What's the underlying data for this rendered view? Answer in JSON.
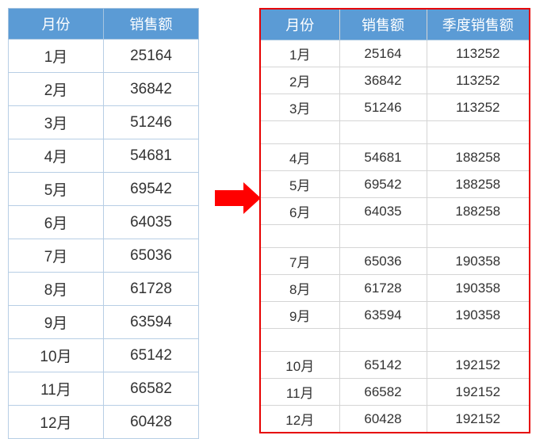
{
  "chart_data": {
    "type": "table",
    "left": {
      "headers": {
        "month": "月份",
        "sales": "销售额"
      },
      "rows": [
        {
          "month": "1月",
          "sales": 25164
        },
        {
          "month": "2月",
          "sales": 36842
        },
        {
          "month": "3月",
          "sales": 51246
        },
        {
          "month": "4月",
          "sales": 54681
        },
        {
          "month": "5月",
          "sales": 69542
        },
        {
          "month": "6月",
          "sales": 64035
        },
        {
          "month": "7月",
          "sales": 65036
        },
        {
          "month": "8月",
          "sales": 61728
        },
        {
          "month": "9月",
          "sales": 63594
        },
        {
          "month": "10月",
          "sales": 65142
        },
        {
          "month": "11月",
          "sales": 66582
        },
        {
          "month": "12月",
          "sales": 60428
        }
      ]
    },
    "right": {
      "headers": {
        "month": "月份",
        "sales": "销售额",
        "qsales": "季度销售额"
      },
      "rows": [
        {
          "month": "1月",
          "sales": 25164,
          "qsales": 113252
        },
        {
          "month": "2月",
          "sales": 36842,
          "qsales": 113252
        },
        {
          "month": "3月",
          "sales": 51246,
          "qsales": 113252
        },
        {
          "blank": true
        },
        {
          "month": "4月",
          "sales": 54681,
          "qsales": 188258
        },
        {
          "month": "5月",
          "sales": 69542,
          "qsales": 188258
        },
        {
          "month": "6月",
          "sales": 64035,
          "qsales": 188258
        },
        {
          "blank": true
        },
        {
          "month": "7月",
          "sales": 65036,
          "qsales": 190358
        },
        {
          "month": "8月",
          "sales": 61728,
          "qsales": 190358
        },
        {
          "month": "9月",
          "sales": 63594,
          "qsales": 190358
        },
        {
          "blank": true
        },
        {
          "month": "10月",
          "sales": 65142,
          "qsales": 192152
        },
        {
          "month": "11月",
          "sales": 66582,
          "qsales": 192152
        },
        {
          "month": "12月",
          "sales": 60428,
          "qsales": 192152
        }
      ]
    }
  }
}
